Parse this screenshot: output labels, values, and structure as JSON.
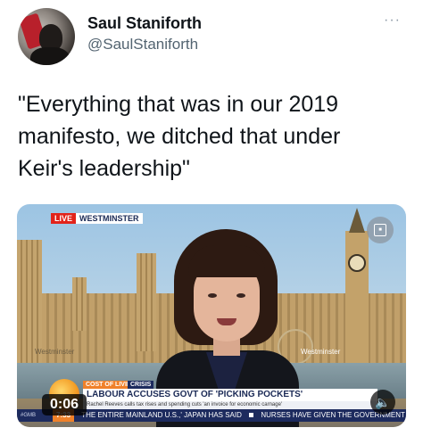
{
  "tweet": {
    "author_name": "Saul Staniforth",
    "author_handle": "@SaulStaniforth",
    "more_icon": "more-horizontal-icon",
    "text": "\"Everything that was in our 2019\nmanifesto, we ditched that under\nKeir's leadership\""
  },
  "media": {
    "type": "video",
    "duration_label": "0:06",
    "volume_icon": "speaker-icon",
    "gif_icon": "gif-icon",
    "broadcast": {
      "live_tag": "LIVE",
      "location_tag": "WESTMINSTER",
      "left_watermark": "Westminster",
      "right_watermark": "Westminster",
      "strap_category": "COST OF LIVING",
      "strap_category2": "CRISIS",
      "headline": "LABOUR ACCUSES GOVT OF 'PICKING POCKETS'",
      "subline": "Rachel Reeves calls tax rises and spending cuts 'an invoice for economic carnage'",
      "ticker_brand": "#GMB",
      "ticker_time": "7:33",
      "ticker_item_1": "THE ENTIRE MAINLAND U.S.,' JAPAN HAS SAID",
      "ticker_item_2": "NURSES HAVE GIVEN THE GOVERNMENT FIVE DA"
    }
  },
  "colors": {
    "text_primary": "#0f1419",
    "text_secondary": "#536471",
    "live_red": "#e2231a",
    "strap_orange": "#f0812a",
    "strap_navy": "#1d2b5e"
  }
}
